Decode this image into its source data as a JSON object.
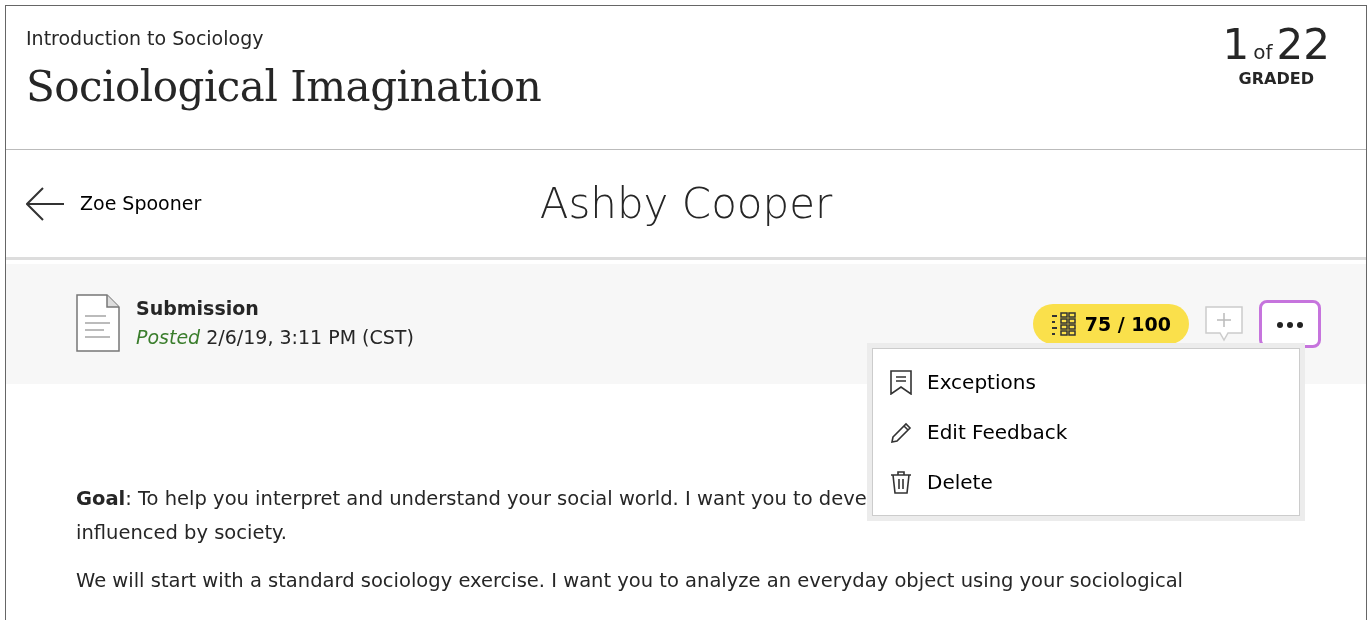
{
  "header": {
    "course": "Introduction to Sociology",
    "title": "Sociological Imagination",
    "counter": {
      "current": "1",
      "of": "of",
      "total": "22",
      "label": "GRADED"
    }
  },
  "student_bar": {
    "previous_student": "Zoe Spooner",
    "student": "Ashby Cooper"
  },
  "submission": {
    "title": "Submission",
    "status": "Posted",
    "date": "2/6/19, 3:11 PM (CST)",
    "grade": "75 / 100",
    "menu_open": true
  },
  "menu": [
    {
      "kind": "exceptions",
      "label": "Exceptions"
    },
    {
      "kind": "edit",
      "label": "Edit Feedback"
    },
    {
      "kind": "delete",
      "label": "Delete"
    }
  ],
  "content": {
    "lines": [
      "**Goal**: To help you interpret and understand your social world. I want you to deve",
      "influenced by society."
    ],
    "paragraph": "We will start with a standard sociology exercise. I want you to analyze an everyday object using your sociological"
  }
}
